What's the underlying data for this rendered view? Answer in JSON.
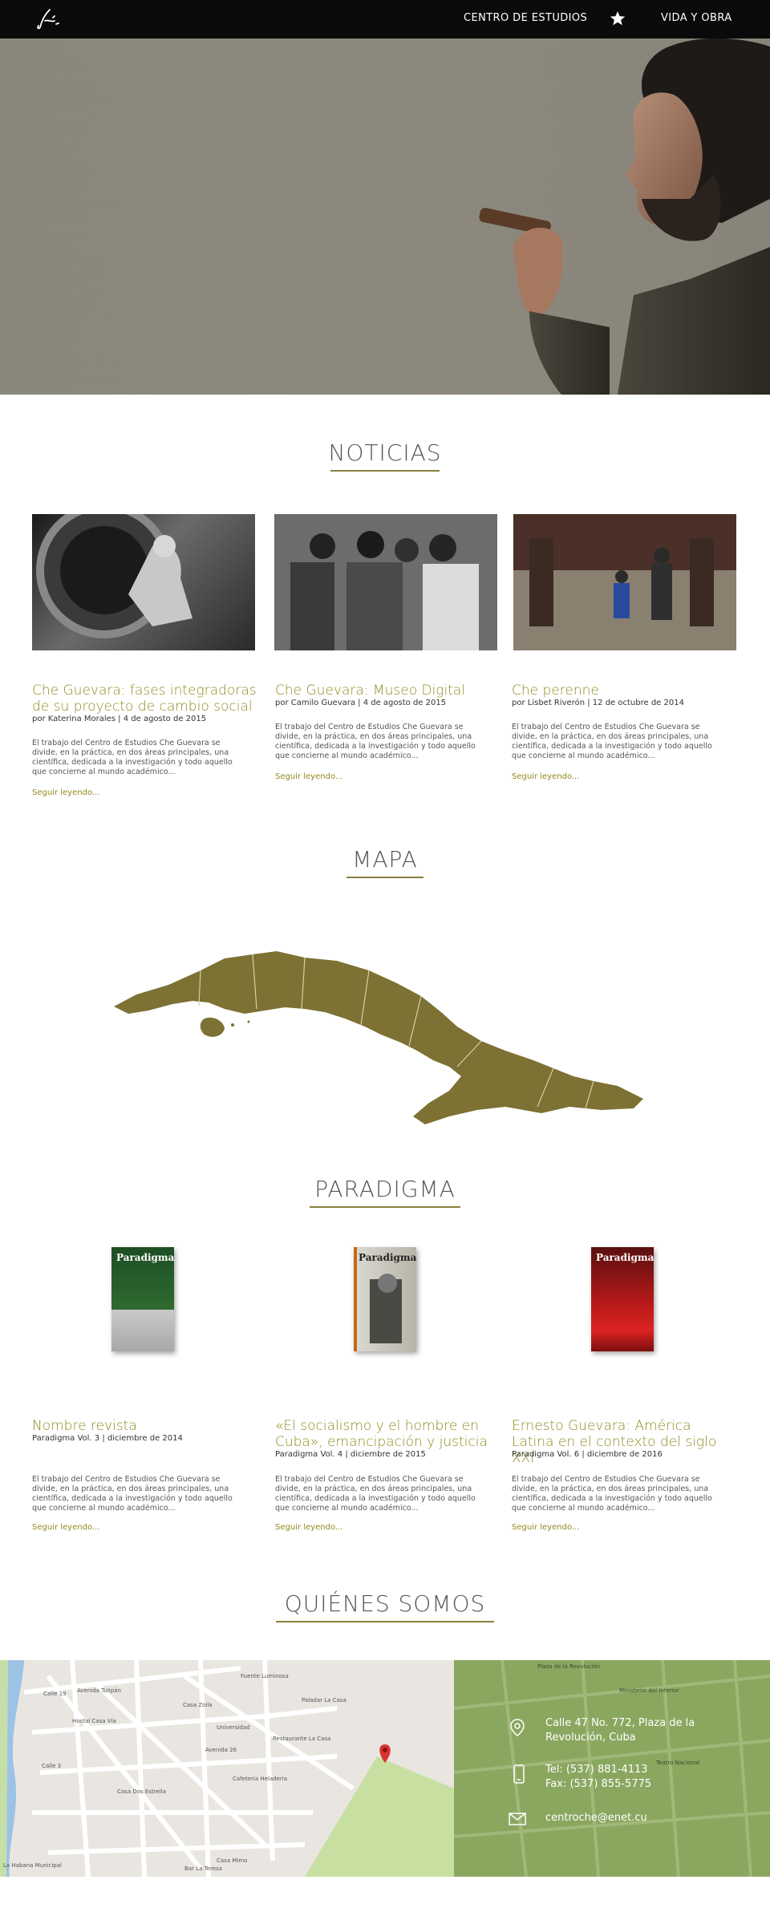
{
  "nav": {
    "logo_icon": "signature-logo-icon",
    "links": [
      {
        "label": "CENTRO DE ESTUDIOS"
      },
      {
        "label": "VIDA Y OBRA"
      }
    ],
    "star_icon": "star-icon"
  },
  "hero": {
    "image": "portrait-with-cigar"
  },
  "noticias": {
    "title": "NOTICIAS",
    "cards": [
      {
        "title": "Che Guevara: fases integradoras de su proyecto de cambio social",
        "meta": "por Katerina Morales | 4 de agosto de 2015",
        "body": "El trabajo del Centro de Estudios Che Guevara se divide, en la práctica, en dos áreas principales, una científica, dedicada a la investigación y todo aquello que concierne al mundo académico...",
        "link": "Seguir leyendo..."
      },
      {
        "title": "Che Guevara: Museo Digital",
        "meta": "por Camilo Guevara | 4 de agosto de 2015",
        "body": "El trabajo del Centro de Estudios Che Guevara se divide, en la práctica, en dos áreas principales, una científica, dedicada a la investigación y todo aquello que concierne al mundo académico...",
        "link": "Seguir leyendo..."
      },
      {
        "title": "Che perenne",
        "meta": "por Lisbet Riverón | 12 de octubre de 2014",
        "body": "El trabajo del Centro de Estudios Che Guevara se divide, en la práctica, en dos áreas principales, una científica, dedicada a la investigación y todo aquello que concierne al mundo académico...",
        "link": "Seguir leyendo..."
      }
    ]
  },
  "mapa": {
    "title": "MAPA",
    "map_color": "#7d7133"
  },
  "paradigma": {
    "title": "PARADIGMA",
    "cards": [
      {
        "cover_label": "Paradigma",
        "title": "Nombre revista",
        "meta": "Paradigma Vol. 3 | diciembre de 2014",
        "body": "El trabajo del Centro de Estudios Che Guevara se divide, en la práctica, en dos áreas principales, una científica, dedicada a la investigación y todo aquello que concierne al mundo académico...",
        "link": "Seguir leyendo..."
      },
      {
        "cover_label": "Paradigma",
        "title": "«El socialismo y el hombre en Cuba», emancipación y justicia",
        "meta": "Paradigma Vol. 4 | diciembre de 2015",
        "body": "El trabajo del Centro de Estudios Che Guevara se divide, en la práctica, en dos áreas principales, una científica, dedicada a la investigación y todo aquello que concierne al mundo académico...",
        "link": "Seguir leyendo..."
      },
      {
        "cover_label": "Paradigma",
        "title": "Ernesto Guevara: América Latina en el contexto del siglo XXI",
        "meta": "Paradigma Vol. 6 | diciembre de 2016",
        "body": "El trabajo del Centro de Estudios Che Guevara se divide, en la práctica, en dos áreas principales, una científica, dedicada a la investigación y todo aquello que concierne al mundo académico...",
        "link": "Seguir leyendo..."
      }
    ]
  },
  "quienes": {
    "title": "QUIÉNES SOMOS",
    "address": "Calle 47 No. 772, Plaza de la Revolución, Cuba",
    "phone": "Tel: (537) 881-4113",
    "fax": "Fax: (537) 855-5775",
    "email": "centroche@enet.cu",
    "icons": [
      "location-pin-icon",
      "phone-icon",
      "envelope-icon"
    ],
    "map_labels": {
      "street1": "Avenida Tulipán",
      "place1": "Casa Zoila",
      "place2": "Fuente Luminosa",
      "place3": "Hostal Casa Vía",
      "place4": "Universidad",
      "place5": "Casa Dos Estrella",
      "place6": "Paladar La Casa",
      "place7": "Cafetería Heladería",
      "street2": "Avenida 26",
      "street3": "Calle 3",
      "street4": "Calle 19",
      "place8": "Restaurante La Casa",
      "place9": "Casa Mimo",
      "place10": "Bar La Teresa",
      "corner_label": "La Habana Municipal",
      "right_top": "Plaza de la Revolución",
      "right_place1": "Ministerio del Interior",
      "right_place2": "Teatro Nacional"
    }
  }
}
